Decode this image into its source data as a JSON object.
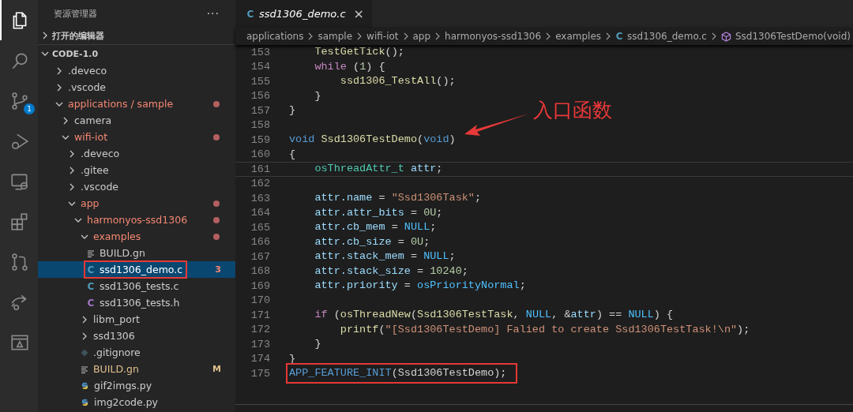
{
  "activity_bar": {
    "items": [
      {
        "kind": "files",
        "selected": true
      },
      {
        "kind": "search",
        "selected": false
      },
      {
        "kind": "source-control",
        "selected": false,
        "badge": "1"
      },
      {
        "kind": "debug",
        "selected": false
      },
      {
        "kind": "remote",
        "selected": false
      },
      {
        "kind": "extensions",
        "selected": false
      },
      {
        "kind": "pull-request",
        "selected": false
      },
      {
        "kind": "share",
        "selected": false
      },
      {
        "kind": "panel",
        "selected": false
      }
    ]
  },
  "sidebar": {
    "title": "资源管理器",
    "more": "···",
    "sections": [
      {
        "label": "打开的编辑器",
        "expanded": false
      },
      {
        "label": "CODE-1.0",
        "expanded": true
      }
    ],
    "tree": [
      {
        "label": ".deveco",
        "kind": "folder",
        "expanded": false,
        "error": false,
        "selected": false,
        "highlighted": false
      },
      {
        "label": ".vscode",
        "kind": "folder",
        "expanded": false,
        "error": false,
        "selected": false,
        "highlighted": false
      },
      {
        "label": "applications / sample",
        "kind": "folder",
        "expanded": true,
        "error": true,
        "selected": false,
        "highlighted": false,
        "children": [
          {
            "label": "camera",
            "kind": "folder",
            "expanded": false,
            "error": false,
            "selected": false,
            "highlighted": false
          },
          {
            "label": "wifi-iot",
            "kind": "folder",
            "expanded": true,
            "error": true,
            "selected": false,
            "highlighted": false,
            "children": [
              {
                "label": ".deveco",
                "kind": "folder",
                "expanded": false,
                "error": false,
                "selected": false,
                "highlighted": false
              },
              {
                "label": ".gitee",
                "kind": "folder",
                "expanded": false,
                "error": false,
                "selected": false,
                "highlighted": false
              },
              {
                "label": ".vscode",
                "kind": "folder",
                "expanded": false,
                "error": false,
                "selected": false,
                "highlighted": false
              },
              {
                "label": "app",
                "kind": "folder",
                "expanded": true,
                "error": true,
                "selected": false,
                "highlighted": false,
                "children": [
                  {
                    "label": "harmonyos-ssd1306",
                    "kind": "folder",
                    "expanded": true,
                    "error": true,
                    "selected": false,
                    "highlighted": false,
                    "children": [
                      {
                        "label": "examples",
                        "kind": "folder",
                        "expanded": true,
                        "error": true,
                        "selected": false,
                        "highlighted": false,
                        "children": [
                          {
                            "label": "BUILD.gn",
                            "kind": "build",
                            "error": false,
                            "selected": false,
                            "highlighted": false
                          },
                          {
                            "label": "ssd1306_demo.c",
                            "kind": "c",
                            "icon": "C",
                            "error": true,
                            "badge": "3",
                            "selected": true,
                            "highlighted": true
                          },
                          {
                            "label": "ssd1306_tests.c",
                            "kind": "c",
                            "icon": "C",
                            "error": false,
                            "selected": false,
                            "highlighted": false
                          },
                          {
                            "label": "ssd1306_tests.h",
                            "kind": "h",
                            "icon": "C",
                            "error": false,
                            "selected": false,
                            "highlighted": false
                          }
                        ]
                      },
                      {
                        "label": "libm_port",
                        "kind": "folder",
                        "expanded": false,
                        "error": false,
                        "selected": false,
                        "highlighted": false
                      },
                      {
                        "label": "ssd1306",
                        "kind": "folder",
                        "expanded": false,
                        "error": false,
                        "selected": false,
                        "highlighted": false
                      },
                      {
                        "label": ".gitignore",
                        "kind": "gitignore",
                        "error": false,
                        "selected": false,
                        "highlighted": false
                      },
                      {
                        "label": "BUILD.gn",
                        "kind": "build",
                        "error": false,
                        "modified": true,
                        "badge": "M",
                        "selected": false,
                        "highlighted": false
                      },
                      {
                        "label": "gif2imgs.py",
                        "kind": "python",
                        "error": false,
                        "selected": false,
                        "highlighted": false
                      },
                      {
                        "label": "img2code.py",
                        "kind": "python",
                        "error": false,
                        "selected": false,
                        "highlighted": false
                      }
                    ]
                  }
                ]
              }
            ]
          }
        ]
      }
    ]
  },
  "editor": {
    "tabs": [
      {
        "label": "ssd1306_demo.c",
        "kind": "c",
        "icon": "C",
        "selected": true,
        "close": "×"
      }
    ],
    "breadcrumbs": [
      {
        "label": "applications",
        "kind": "folder"
      },
      {
        "label": "sample",
        "kind": "folder"
      },
      {
        "label": "wifi-iot",
        "kind": "folder"
      },
      {
        "label": "app",
        "kind": "folder"
      },
      {
        "label": "harmonyos-ssd1306",
        "kind": "folder"
      },
      {
        "label": "examples",
        "kind": "folder"
      },
      {
        "label": "ssd1306_demo.c",
        "kind": "c",
        "icon": "C"
      },
      {
        "label": "Ssd1306TestDemo(void)",
        "kind": "symbol"
      }
    ],
    "lines": [
      {
        "number": "153",
        "current": false,
        "tokens": [
          {
            "t": "    TestGetTick",
            "kind": "function"
          },
          {
            "t": "();",
            "kind": "plain"
          }
        ]
      },
      {
        "number": "154",
        "current": false,
        "tokens": [
          {
            "t": "    while",
            "kind": "keyword"
          },
          {
            "t": " (",
            "kind": "plain"
          },
          {
            "t": "1",
            "kind": "number"
          },
          {
            "t": ") {",
            "kind": "plain"
          }
        ]
      },
      {
        "number": "155",
        "current": false,
        "tokens": [
          {
            "t": "        ssd1306_TestAll",
            "kind": "function"
          },
          {
            "t": "();",
            "kind": "plain"
          }
        ]
      },
      {
        "number": "156",
        "current": false,
        "tokens": [
          {
            "t": "    }",
            "kind": "plain"
          }
        ]
      },
      {
        "number": "157",
        "current": false,
        "tokens": [
          {
            "t": "}",
            "kind": "plain"
          }
        ]
      },
      {
        "number": "158",
        "current": false
      },
      {
        "number": "159",
        "current": false,
        "tokens": [
          {
            "t": "void",
            "kind": "storage"
          },
          {
            "t": " Ssd1306TestDemo",
            "kind": "function"
          },
          {
            "t": "(",
            "kind": "plain"
          },
          {
            "t": "void",
            "kind": "storage"
          },
          {
            "t": ")",
            "kind": "plain"
          }
        ]
      },
      {
        "number": "160",
        "current": false,
        "tokens": [
          {
            "t": "{",
            "kind": "plain"
          }
        ]
      },
      {
        "number": "161",
        "current": true,
        "tokens": [
          {
            "t": "    osThreadAttr_t",
            "kind": "type"
          },
          {
            "t": " attr",
            "kind": "variable"
          },
          {
            "t": ";",
            "kind": "plain"
          }
        ]
      },
      {
        "number": "162",
        "current": false
      },
      {
        "number": "163",
        "current": false,
        "tokens": [
          {
            "t": "    attr.name",
            "kind": "variable"
          },
          {
            "t": " = ",
            "kind": "plain"
          },
          {
            "t": "\"Ssd1306Task\"",
            "kind": "string"
          },
          {
            "t": ";",
            "kind": "plain"
          }
        ]
      },
      {
        "number": "164",
        "current": false,
        "tokens": [
          {
            "t": "    attr.attr_bits",
            "kind": "variable"
          },
          {
            "t": " = ",
            "kind": "plain"
          },
          {
            "t": "0U",
            "kind": "number"
          },
          {
            "t": ";",
            "kind": "plain"
          }
        ]
      },
      {
        "number": "165",
        "current": false,
        "tokens": [
          {
            "t": "    attr.cb_mem",
            "kind": "variable"
          },
          {
            "t": " = ",
            "kind": "plain"
          },
          {
            "t": "NULL",
            "kind": "constant"
          },
          {
            "t": ";",
            "kind": "plain"
          }
        ]
      },
      {
        "number": "166",
        "current": false,
        "tokens": [
          {
            "t": "    attr.cb_size",
            "kind": "variable"
          },
          {
            "t": " = ",
            "kind": "plain"
          },
          {
            "t": "0U",
            "kind": "number"
          },
          {
            "t": ";",
            "kind": "plain"
          }
        ]
      },
      {
        "number": "167",
        "current": false,
        "tokens": [
          {
            "t": "    attr.stack_mem",
            "kind": "variable"
          },
          {
            "t": " = ",
            "kind": "plain"
          },
          {
            "t": "NULL",
            "kind": "constant"
          },
          {
            "t": ";",
            "kind": "plain"
          }
        ]
      },
      {
        "number": "168",
        "current": false,
        "tokens": [
          {
            "t": "    attr.stack_size",
            "kind": "variable"
          },
          {
            "t": " = ",
            "kind": "plain"
          },
          {
            "t": "10240",
            "kind": "number"
          },
          {
            "t": ";",
            "kind": "plain"
          }
        ]
      },
      {
        "number": "169",
        "current": false,
        "tokens": [
          {
            "t": "    attr.priority",
            "kind": "variable"
          },
          {
            "t": " = ",
            "kind": "plain"
          },
          {
            "t": "osPriorityNormal",
            "kind": "constant"
          },
          {
            "t": ";",
            "kind": "plain"
          }
        ]
      },
      {
        "number": "170",
        "current": false
      },
      {
        "number": "171",
        "current": false,
        "tokens": [
          {
            "t": "    if",
            "kind": "keyword"
          },
          {
            "t": " (",
            "kind": "plain"
          },
          {
            "t": "osThreadNew",
            "kind": "function"
          },
          {
            "t": "(",
            "kind": "plain"
          },
          {
            "t": "Ssd1306TestTask",
            "kind": "function"
          },
          {
            "t": ", ",
            "kind": "plain"
          },
          {
            "t": "NULL",
            "kind": "constant"
          },
          {
            "t": ", &",
            "kind": "plain"
          },
          {
            "t": "attr",
            "kind": "variable"
          },
          {
            "t": ") == ",
            "kind": "plain"
          },
          {
            "t": "NULL",
            "kind": "constant"
          },
          {
            "t": ") {",
            "kind": "plain"
          }
        ]
      },
      {
        "number": "172",
        "current": false,
        "tokens": [
          {
            "t": "        printf",
            "kind": "function"
          },
          {
            "t": "(",
            "kind": "plain"
          },
          {
            "t": "\"[Ssd1306TestDemo] Falied to create Ssd1306TestTask!\\n\"",
            "kind": "string"
          },
          {
            "t": ");",
            "kind": "plain"
          }
        ]
      },
      {
        "number": "173",
        "current": false,
        "tokens": [
          {
            "t": "    }",
            "kind": "plain"
          }
        ]
      },
      {
        "number": "174",
        "current": false,
        "tokens": [
          {
            "t": "}",
            "kind": "plain"
          }
        ]
      },
      {
        "number": "175",
        "current": false,
        "highlighted": true,
        "tokens": [
          {
            "t": "APP_FEATURE_INIT",
            "kind": "storage"
          },
          {
            "t": "(Ssd1306TestDemo);",
            "kind": "plain"
          }
        ]
      }
    ],
    "annotation": {
      "text": "入口函数"
    }
  }
}
